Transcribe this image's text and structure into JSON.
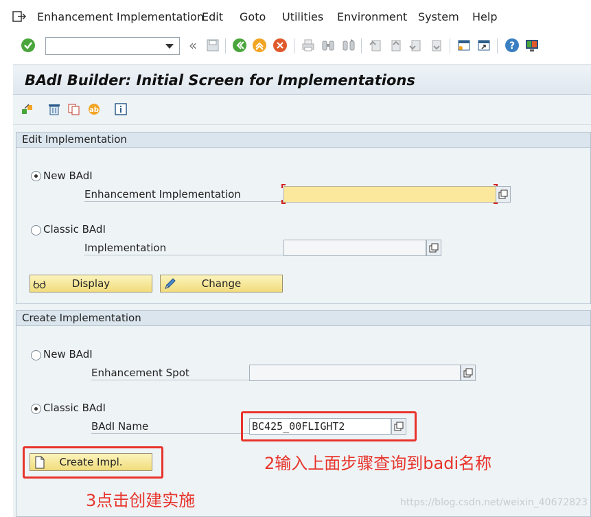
{
  "menubar": {
    "items": [
      "Enhancement Implementation",
      "Edit",
      "Goto",
      "Utilities",
      "Environment",
      "System",
      "Help"
    ]
  },
  "toolbar": {
    "command_field_value": ""
  },
  "screen": {
    "title": "BAdI Builder: Initial Screen for Implementations"
  },
  "edit_group": {
    "header": "Edit Implementation",
    "new_badi_label": "New BAdI",
    "enh_impl_label": "Enhancement Implementation",
    "enh_impl_value": "",
    "classic_badi_label": "Classic BAdI",
    "impl_label": "Implementation",
    "impl_value": "",
    "display_label": "Display",
    "change_label": "Change"
  },
  "create_group": {
    "header": "Create Implementation",
    "new_badi_label": "New BAdI",
    "enh_spot_label": "Enhancement Spot",
    "enh_spot_value": "",
    "classic_badi_label": "Classic BAdI",
    "badi_name_label": "BAdI Name",
    "badi_name_value": "BC425_00FLIGHT2",
    "create_label": "Create Impl."
  },
  "annotations": {
    "note2": "2输入上面步骤查询到badi名称",
    "note3": "3点击创建实施",
    "color": "#e8332a"
  },
  "watermark": "https://blog.csdn.net/weixin_40672823"
}
